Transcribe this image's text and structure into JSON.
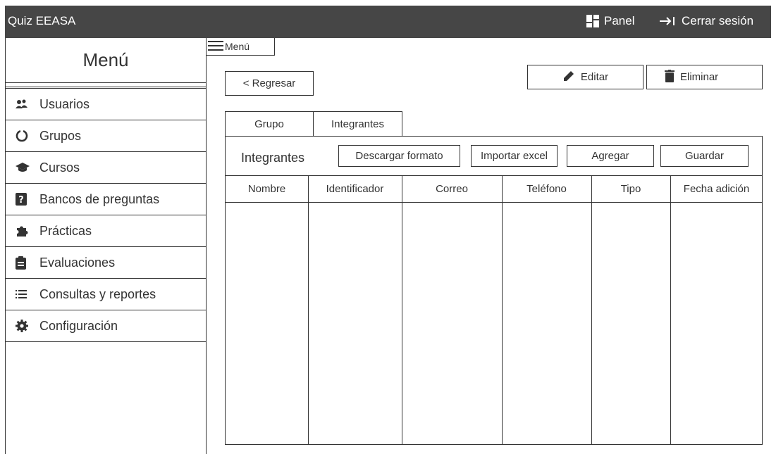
{
  "app": {
    "title": "Quiz EEASA",
    "panel_label": "Panel",
    "logout_label": "Cerrar sesión"
  },
  "sidebar": {
    "title": "Menú",
    "items": [
      {
        "label": "Usuarios",
        "icon": "users-icon"
      },
      {
        "label": "Grupos",
        "icon": "circle-notch-icon"
      },
      {
        "label": "Cursos",
        "icon": "graduation-cap-icon"
      },
      {
        "label": "Bancos de preguntas",
        "icon": "question-square-icon"
      },
      {
        "label": "Prácticas",
        "icon": "puzzle-icon"
      },
      {
        "label": "Evaluaciones",
        "icon": "clipboard-icon"
      },
      {
        "label": "Consultas y reportes",
        "icon": "list-icon"
      },
      {
        "label": "Configuración",
        "icon": "gear-icon"
      }
    ]
  },
  "menu_toggle": {
    "label": "Menú",
    "icon": "hamburger-icon"
  },
  "toolbar": {
    "back_label": "< Regresar",
    "edit_label": "Editar",
    "delete_label": "Eliminar"
  },
  "tabs": [
    {
      "label": "Grupo"
    },
    {
      "label": "Integrantes"
    }
  ],
  "members": {
    "title": "Integrantes",
    "download_label": "Descargar formato",
    "import_label": "Importar excel",
    "add_label": "Agregar",
    "save_label": "Guardar",
    "columns": [
      "Nombre",
      "Identificador",
      "Correo",
      "Teléfono",
      "Tipo",
      "Fecha adición"
    ],
    "rows": []
  }
}
